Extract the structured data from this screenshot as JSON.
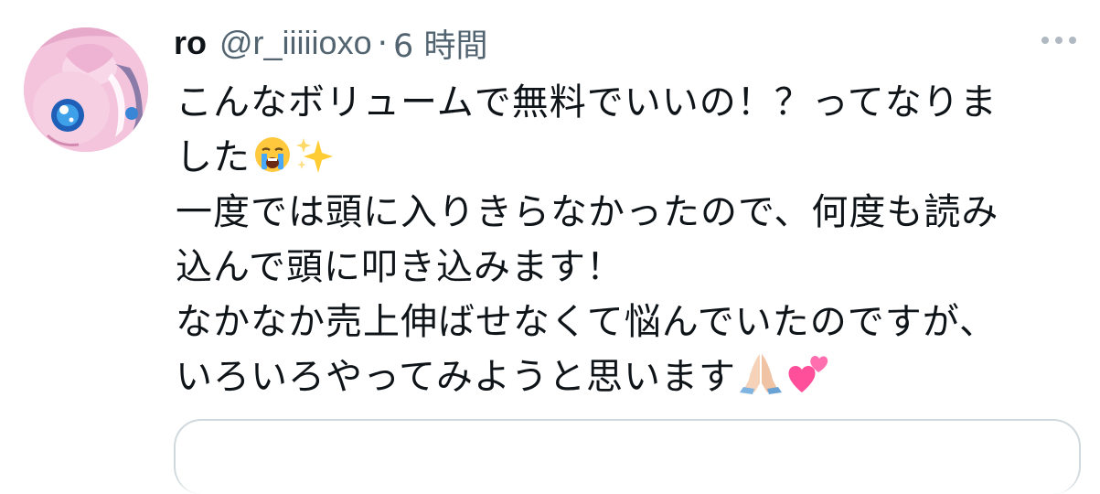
{
  "tweet": {
    "display_name": "ro",
    "handle": "@r_iiiiioxo",
    "separator": "·",
    "time": "6 時間",
    "lines": [
      "こんなボリュームで無料でいいの！？ってなりま",
      "した",
      "一度では頭に入りきらなかったので、何度も読み",
      "込んで頭に叩き込みます！",
      "なかなか売上伸ばせなくて悩んでいたのですが、",
      "いろいろやってみようと思います"
    ],
    "icons": {
      "avatar": "avatar-illustration",
      "more": "more-icon",
      "emoji_line2": [
        "crying-face-icon",
        "sparkles-icon"
      ],
      "emoji_line6": [
        "folded-hands-icon",
        "two-hearts-icon"
      ]
    },
    "colors": {
      "text": "#0f1419",
      "secondary": "#536471",
      "border": "#cfd9de"
    }
  }
}
